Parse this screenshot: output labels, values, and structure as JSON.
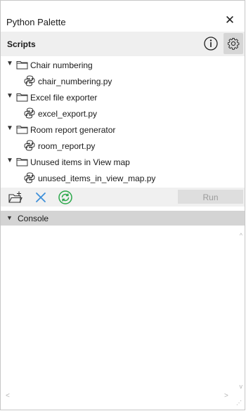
{
  "window": {
    "title": "Python Palette",
    "close_glyph": "✕"
  },
  "scripts": {
    "header": "Scripts",
    "info_icon": "info-icon",
    "settings_icon": "gear-icon"
  },
  "folders": [
    {
      "name": "Chair numbering",
      "script": "chair_numbering.py",
      "expanded": true
    },
    {
      "name": "Excel file exporter",
      "script": "excel_export.py",
      "expanded": true
    },
    {
      "name": "Room report generator",
      "script": "room_report.py",
      "expanded": true
    },
    {
      "name": "Unused items in View map",
      "script": "unused_items_in_view_map.py",
      "expanded": true
    }
  ],
  "toolbar": {
    "add_icon": "add-folder-icon",
    "remove_icon": "delete-icon",
    "reload_icon": "reload-icon",
    "run_label": "Run",
    "run_enabled": false
  },
  "console": {
    "label": "Console",
    "expanded": true,
    "content": ""
  },
  "colors": {
    "accent_blue": "#3d8fd9",
    "reload_green": "#2aa84a",
    "header_gray": "#efefef",
    "console_header": "#d4d4d4"
  }
}
